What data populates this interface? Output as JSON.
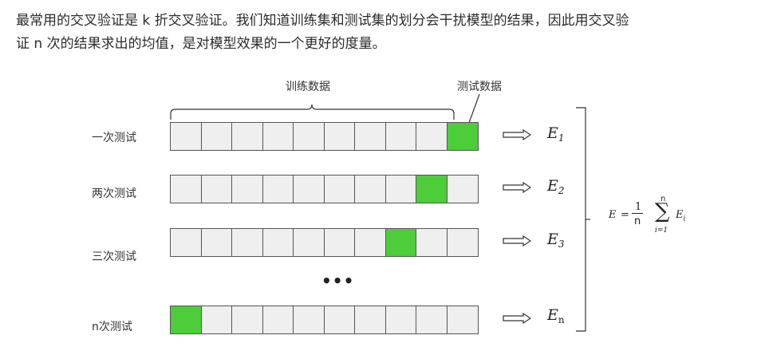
{
  "paragraph": {
    "line1": "最常用的交叉验证是 k 折交叉验证。我们知道训练集和测试集的划分会干扰模型的结果，因此用交叉验",
    "line2": "证 n 次的结果求出的均值，是对模型效果的一个更好的度量。"
  },
  "figure": {
    "train_label": "训练数据",
    "test_label": "测试数据",
    "ellipsis": "•••",
    "cells_per_row": 10,
    "colors": {
      "cell_fill": "#efefef",
      "test_fill": "#4ccd39",
      "border": "#555555"
    },
    "rows": [
      {
        "label": "一次测试",
        "test_index": 9,
        "result": "E",
        "subscript": "1"
      },
      {
        "label": "两次测试",
        "test_index": 8,
        "result": "E",
        "subscript": "2"
      },
      {
        "label": "三次测试",
        "test_index": 7,
        "result": "E",
        "subscript": "3"
      },
      {
        "label": "n次测试",
        "test_index": 0,
        "result": "E",
        "subscript": "n"
      }
    ],
    "formula": {
      "lhs": "E",
      "equals": "=",
      "numerator": "1",
      "denominator": "n",
      "sum_top": "n",
      "sum_bottom": "i=1",
      "sigma": "∑",
      "term": "E",
      "term_sub": "i"
    }
  }
}
